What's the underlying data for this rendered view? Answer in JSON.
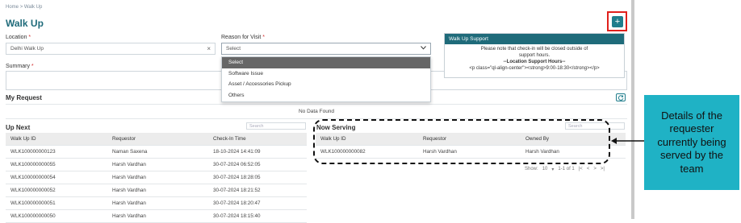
{
  "breadcrumb": {
    "home": "Home",
    "sep": ">",
    "current": "Walk Up"
  },
  "page_title": "Walk Up",
  "add_button": "+",
  "form": {
    "location_label": "Location",
    "location_value": "Delhi Walk Up",
    "location_clear": "×",
    "reason_label": "Reason for Visit",
    "reason_value": "Select",
    "required_mark": "*",
    "summary_label": "Summary"
  },
  "reason_options": [
    "Select",
    "Software Issue",
    "Asset / Accessories Pickup",
    "Others"
  ],
  "support": {
    "header": "Walk Up Support",
    "line1": "Please note that check-in will be closed outside of",
    "line2": "support hours.",
    "line3": "--Location Support Hours--",
    "line4": "<p class=\"ql-align-center\"><strong>9:00-18:30</strong></p>"
  },
  "my_request": {
    "title": "My Request",
    "empty": "No Data Found"
  },
  "up_next": {
    "title": "Up Next",
    "search_placeholder": "Search",
    "columns": [
      "Walk Up ID",
      "Requestor",
      "Check-In Time"
    ],
    "rows": [
      [
        "WLK100000000123",
        "Naman Saxena",
        "18-10-2024 14:41:09"
      ],
      [
        "WLK100000000055",
        "Harsh Vardhan",
        "30-07-2024 06:52:05"
      ],
      [
        "WLK100000000054",
        "Harsh Vardhan",
        "30-07-2024 18:28:05"
      ],
      [
        "WLK100000000052",
        "Harsh Vardhan",
        "30-07-2024 18:21:52"
      ],
      [
        "WLK100000000051",
        "Harsh Vardhan",
        "30-07-2024 18:20:47"
      ],
      [
        "WLK100000000050",
        "Harsh Vardhan",
        "30-07-2024 18:15:40"
      ]
    ]
  },
  "now_serving": {
    "title": "Now Serving",
    "search_placeholder": "Search",
    "columns": [
      "Walk Up ID",
      "Requestor",
      "Owned By"
    ],
    "rows": [
      [
        "WLK100000000082",
        "Harsh Vardhan",
        "Harsh Vardhan"
      ]
    ],
    "pagination": {
      "show_label": "Show:",
      "page_size": "10",
      "range": "1-1 of 1",
      "first": "|<",
      "prev": "<",
      "next": ">",
      "last": ">|"
    }
  },
  "annotation": {
    "text": "Details of the requester currently being served by the team"
  },
  "colors": {
    "accent": "#1f6b7a",
    "callout": "#1fb2c5",
    "highlight": "#e0201c"
  }
}
